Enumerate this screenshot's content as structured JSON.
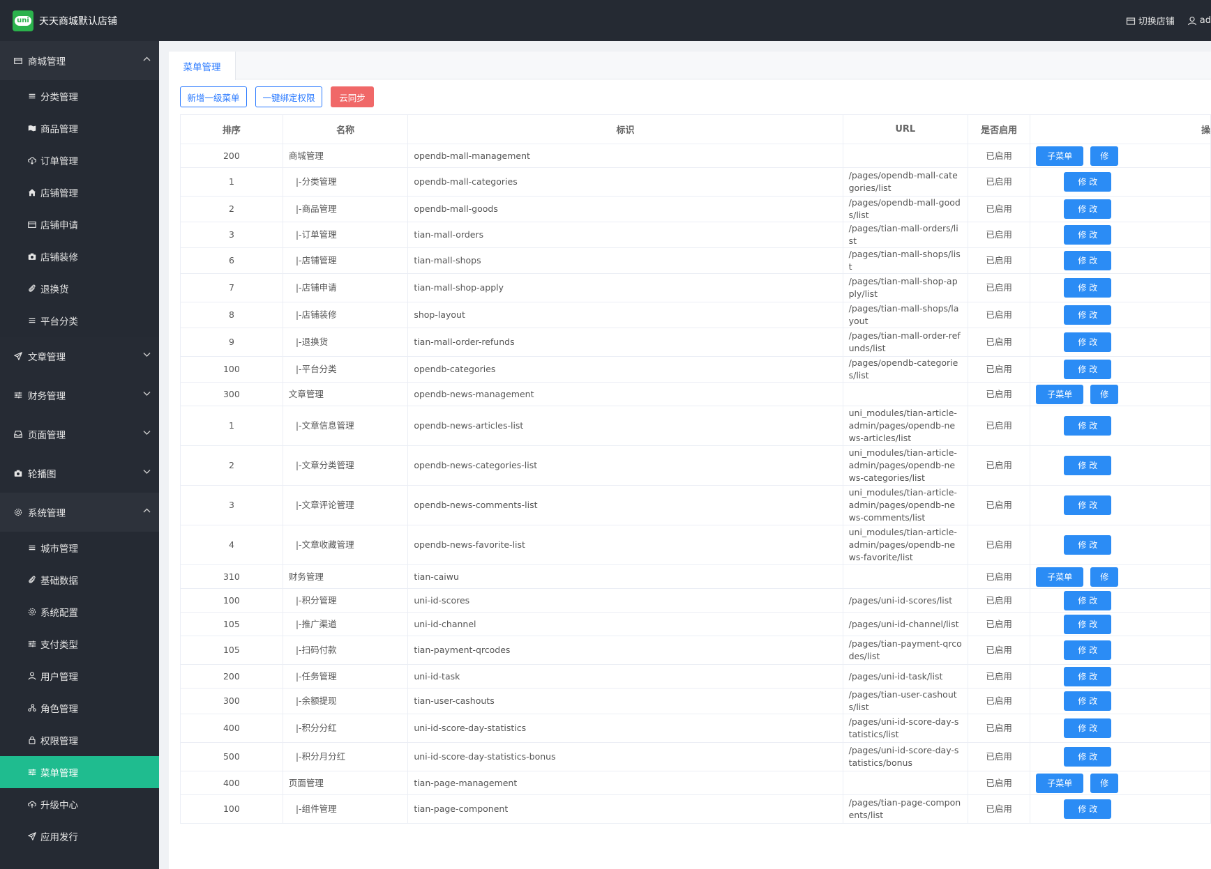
{
  "app": {
    "title": "天天商城默认店铺",
    "logo_text": "uni"
  },
  "header": {
    "switch_shop": "切换店铺",
    "user": "ad"
  },
  "sidebar": {
    "groups": [
      {
        "label": "商城管理",
        "icon": "shop-icon",
        "open": true,
        "items": [
          {
            "label": "分类管理",
            "icon": "list-icon"
          },
          {
            "label": "商品管理",
            "icon": "map-icon"
          },
          {
            "label": "订单管理",
            "icon": "cloud-download-icon"
          },
          {
            "label": "店铺管理",
            "icon": "home-icon"
          },
          {
            "label": "店铺申请",
            "icon": "shop-icon"
          },
          {
            "label": "店铺装修",
            "icon": "camera-icon"
          },
          {
            "label": "退换货",
            "icon": "paperclip-icon"
          },
          {
            "label": "平台分类",
            "icon": "list-icon"
          }
        ]
      },
      {
        "label": "文章管理",
        "icon": "send-icon",
        "open": false
      },
      {
        "label": "财务管理",
        "icon": "sliders-icon",
        "open": false
      },
      {
        "label": "页面管理",
        "icon": "inbox-icon",
        "open": false
      },
      {
        "label": "轮播图",
        "icon": "camera-icon",
        "open": false
      },
      {
        "label": "系统管理",
        "icon": "gear-icon",
        "open": true,
        "items": [
          {
            "label": "城市管理",
            "icon": "list-icon"
          },
          {
            "label": "基础数据",
            "icon": "paperclip-icon"
          },
          {
            "label": "系统配置",
            "icon": "gear-icon"
          },
          {
            "label": "支付类型",
            "icon": "sliders-icon"
          },
          {
            "label": "用户管理",
            "icon": "person-icon"
          },
          {
            "label": "角色管理",
            "icon": "people-icon"
          },
          {
            "label": "权限管理",
            "icon": "lock-icon"
          },
          {
            "label": "菜单管理",
            "icon": "sliders-icon",
            "active": true
          },
          {
            "label": "升级中心",
            "icon": "cloud-upload-icon"
          },
          {
            "label": "应用发行",
            "icon": "send-icon"
          }
        ]
      }
    ]
  },
  "tab": {
    "label": "菜单管理"
  },
  "toolbar": {
    "add_label": "新增一级菜单",
    "bind_label": "一键绑定权限",
    "sync_label": "云同步"
  },
  "table": {
    "columns": [
      "排序",
      "名称",
      "标识",
      "URL",
      "是否启用",
      "操"
    ],
    "sub_label": "子菜单",
    "edit_label": "修 改",
    "edit_short": "修",
    "rows": [
      {
        "sort": "200",
        "name": "商城管理",
        "id": "opendb-mall-management",
        "url": "",
        "status": "已启用",
        "top": true
      },
      {
        "sort": "1",
        "name": "|-分类管理",
        "id": "opendb-mall-categories",
        "url": "/pages/opendb-mall-categories/list",
        "status": "已启用"
      },
      {
        "sort": "2",
        "name": "|-商品管理",
        "id": "opendb-mall-goods",
        "url": "/pages/opendb-mall-goods/list",
        "status": "已启用"
      },
      {
        "sort": "3",
        "name": "|-订单管理",
        "id": "tian-mall-orders",
        "url": "/pages/tian-mall-orders/list",
        "status": "已启用"
      },
      {
        "sort": "6",
        "name": "|-店铺管理",
        "id": "tian-mall-shops",
        "url": "/pages/tian-mall-shops/list",
        "status": "已启用"
      },
      {
        "sort": "7",
        "name": "|-店铺申请",
        "id": "tian-mall-shop-apply",
        "url": "/pages/tian-mall-shop-apply/list",
        "status": "已启用"
      },
      {
        "sort": "8",
        "name": "|-店铺装修",
        "id": "shop-layout",
        "url": "/pages/tian-mall-shops/layout",
        "status": "已启用"
      },
      {
        "sort": "9",
        "name": "|-退换货",
        "id": "tian-mall-order-refunds",
        "url": "/pages/tian-mall-order-refunds/list",
        "status": "已启用"
      },
      {
        "sort": "100",
        "name": "|-平台分类",
        "id": "opendb-categories",
        "url": "/pages/opendb-categories/list",
        "status": "已启用"
      },
      {
        "sort": "300",
        "name": "文章管理",
        "id": "opendb-news-management",
        "url": "",
        "status": "已启用",
        "top": true
      },
      {
        "sort": "1",
        "name": "|-文章信息管理",
        "id": "opendb-news-articles-list",
        "url": "uni_modules/tian-article-admin/pages/opendb-news-articles/list",
        "status": "已启用"
      },
      {
        "sort": "2",
        "name": "|-文章分类管理",
        "id": "opendb-news-categories-list",
        "url": "uni_modules/tian-article-admin/pages/opendb-news-categories/list",
        "status": "已启用"
      },
      {
        "sort": "3",
        "name": "|-文章评论管理",
        "id": "opendb-news-comments-list",
        "url": "uni_modules/tian-article-admin/pages/opendb-news-comments/list",
        "status": "已启用"
      },
      {
        "sort": "4",
        "name": "|-文章收藏管理",
        "id": "opendb-news-favorite-list",
        "url": "uni_modules/tian-article-admin/pages/opendb-news-favorite/list",
        "status": "已启用"
      },
      {
        "sort": "310",
        "name": "财务管理",
        "id": "tian-caiwu",
        "url": "",
        "status": "已启用",
        "top": true
      },
      {
        "sort": "100",
        "name": "|-积分管理",
        "id": "uni-id-scores",
        "url": "/pages/uni-id-scores/list",
        "status": "已启用"
      },
      {
        "sort": "105",
        "name": "|-推广渠道",
        "id": "uni-id-channel",
        "url": "/pages/uni-id-channel/list",
        "status": "已启用"
      },
      {
        "sort": "105",
        "name": "|-扫码付款",
        "id": "tian-payment-qrcodes",
        "url": "/pages/tian-payment-qrcodes/list",
        "status": "已启用"
      },
      {
        "sort": "200",
        "name": "|-任务管理",
        "id": "uni-id-task",
        "url": "/pages/uni-id-task/list",
        "status": "已启用"
      },
      {
        "sort": "300",
        "name": "|-余额提现",
        "id": "tian-user-cashouts",
        "url": "/pages/tian-user-cashouts/list",
        "status": "已启用"
      },
      {
        "sort": "400",
        "name": "|-积分分红",
        "id": "uni-id-score-day-statistics",
        "url": "/pages/uni-id-score-day-statistics/list",
        "status": "已启用"
      },
      {
        "sort": "500",
        "name": "|-积分月分红",
        "id": "uni-id-score-day-statistics-bonus",
        "url": "/pages/uni-id-score-day-statistics/bonus",
        "status": "已启用"
      },
      {
        "sort": "400",
        "name": "页面管理",
        "id": "tian-page-management",
        "url": "",
        "status": "已启用",
        "top": true
      },
      {
        "sort": "100",
        "name": "|-组件管理",
        "id": "tian-page-component",
        "url": "/pages/tian-page-components/list",
        "status": "已启用"
      }
    ]
  }
}
